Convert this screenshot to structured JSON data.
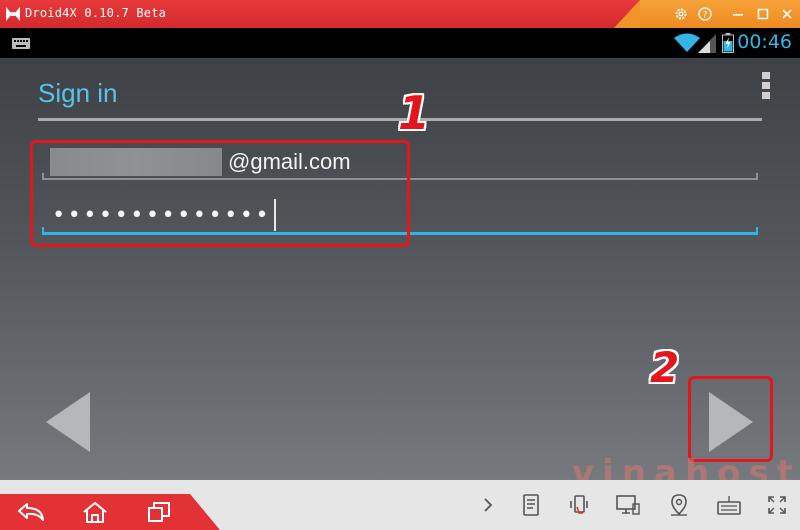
{
  "window": {
    "title": "Droid4X 0.10.7 Beta"
  },
  "status": {
    "time": "00:46"
  },
  "signin": {
    "heading": "Sign in",
    "email_suffix": "@gmail.com",
    "password_mask": "••••••••••••••"
  },
  "annotations": {
    "step1": "1",
    "step2": "2"
  },
  "watermark": {
    "text": "vinahost.vn"
  },
  "colors": {
    "accent": "#33b5e5",
    "titlebar": "#e23236",
    "annotation": "#e3161b"
  }
}
